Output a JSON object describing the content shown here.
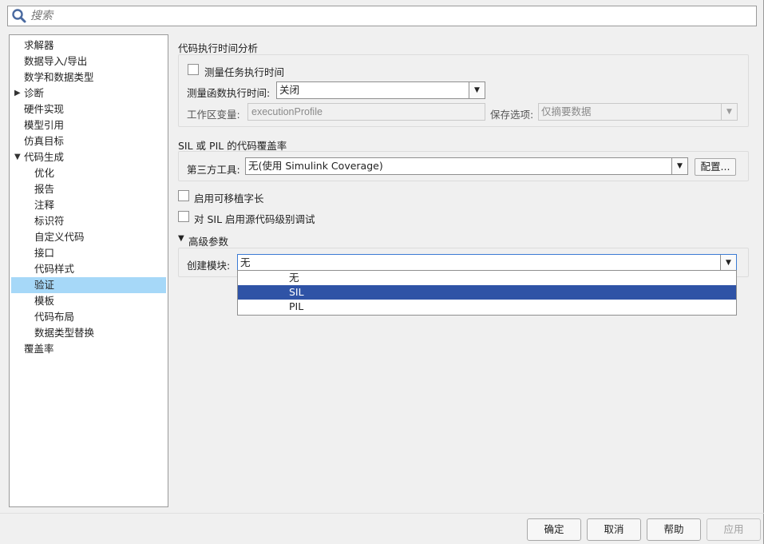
{
  "search": {
    "placeholder": "搜索"
  },
  "tree": {
    "items": [
      {
        "label": "求解器",
        "level": 0,
        "arrow": ""
      },
      {
        "label": "数据导入/导出",
        "level": 0,
        "arrow": ""
      },
      {
        "label": "数学和数据类型",
        "level": 0,
        "arrow": ""
      },
      {
        "label": "诊断",
        "level": 0,
        "arrow": "▶"
      },
      {
        "label": "硬件实现",
        "level": 0,
        "arrow": ""
      },
      {
        "label": "模型引用",
        "level": 0,
        "arrow": ""
      },
      {
        "label": "仿真目标",
        "level": 0,
        "arrow": ""
      },
      {
        "label": "代码生成",
        "level": 0,
        "arrow": "▼"
      },
      {
        "label": "优化",
        "level": 1,
        "arrow": ""
      },
      {
        "label": "报告",
        "level": 1,
        "arrow": ""
      },
      {
        "label": "注释",
        "level": 1,
        "arrow": ""
      },
      {
        "label": "标识符",
        "level": 1,
        "arrow": ""
      },
      {
        "label": "自定义代码",
        "level": 1,
        "arrow": ""
      },
      {
        "label": "接口",
        "level": 1,
        "arrow": ""
      },
      {
        "label": "代码样式",
        "level": 1,
        "arrow": ""
      },
      {
        "label": "验证",
        "level": 1,
        "arrow": "",
        "selected": true
      },
      {
        "label": "模板",
        "level": 1,
        "arrow": ""
      },
      {
        "label": "代码布局",
        "level": 1,
        "arrow": ""
      },
      {
        "label": "数据类型替换",
        "level": 1,
        "arrow": ""
      },
      {
        "label": "覆盖率",
        "level": 0,
        "arrow": ""
      }
    ]
  },
  "profiling": {
    "title": "代码执行时间分析",
    "measure_task_label": "测量任务执行时间",
    "measure_func_label": "测量函数执行时间:",
    "measure_func_value": "关闭",
    "workspace_var_label": "工作区变量:",
    "workspace_var_value": "executionProfile",
    "save_option_label": "保存选项:",
    "save_option_value": "仅摘要数据"
  },
  "coverage": {
    "title": "SIL 或 PIL 的代码覆盖率",
    "third_party_label": "第三方工具:",
    "third_party_value": "无(使用 Simulink Coverage)",
    "config_button": "配置..."
  },
  "options": {
    "portable_word_sizes": "启用可移植字长",
    "sil_debug": "对 SIL 启用源代码级别调试"
  },
  "advanced": {
    "title": "高级参数",
    "create_block_label": "创建模块:",
    "create_block_value": "无",
    "dropdown_options": [
      "无",
      "SIL",
      "PIL"
    ]
  },
  "footer": {
    "ok": "确定",
    "cancel": "取消",
    "help": "帮助",
    "apply": "应用"
  }
}
